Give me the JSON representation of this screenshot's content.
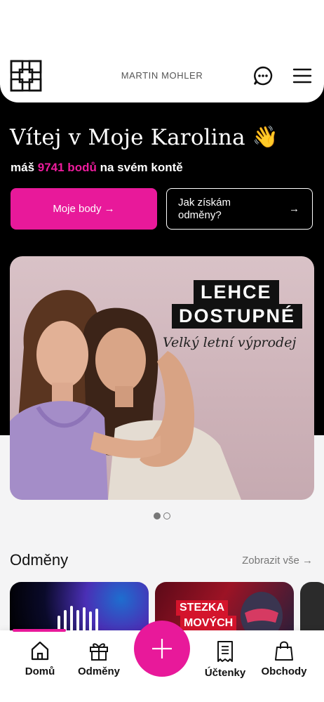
{
  "header": {
    "user_name": "MARTIN MOHLER"
  },
  "hero": {
    "welcome_text": "Vítej v Moje Karolina",
    "wave_emoji": "👋",
    "points_prefix": "máš",
    "points_value": "9741 bodů",
    "points_suffix": "na svém kontě",
    "primary_button": "Moje body →",
    "secondary_button": "Jak získám odměny?",
    "secondary_arrow": "→"
  },
  "banner": {
    "tag_line1": "LEHCE",
    "tag_line2": "DOSTUPNÉ",
    "subtitle": "Velký letní výprodej",
    "dots_total": 2,
    "dots_active": 1
  },
  "rewards": {
    "title": "Odměny",
    "see_all": "Zobrazit vše →",
    "card2_line1": "STEZKA",
    "card2_line2": "MOVÝCH"
  },
  "bottom_nav": {
    "items": [
      {
        "label": "Domů",
        "icon": "home-icon"
      },
      {
        "label": "Odměny",
        "icon": "gift-icon"
      },
      {
        "label": "Účtenky",
        "icon": "receipt-icon"
      },
      {
        "label": "Obchody",
        "icon": "shopping-bag-icon"
      }
    ],
    "fab_icon": "plus-icon"
  },
  "colors": {
    "accent": "#e8199a",
    "dark": "#000000"
  }
}
